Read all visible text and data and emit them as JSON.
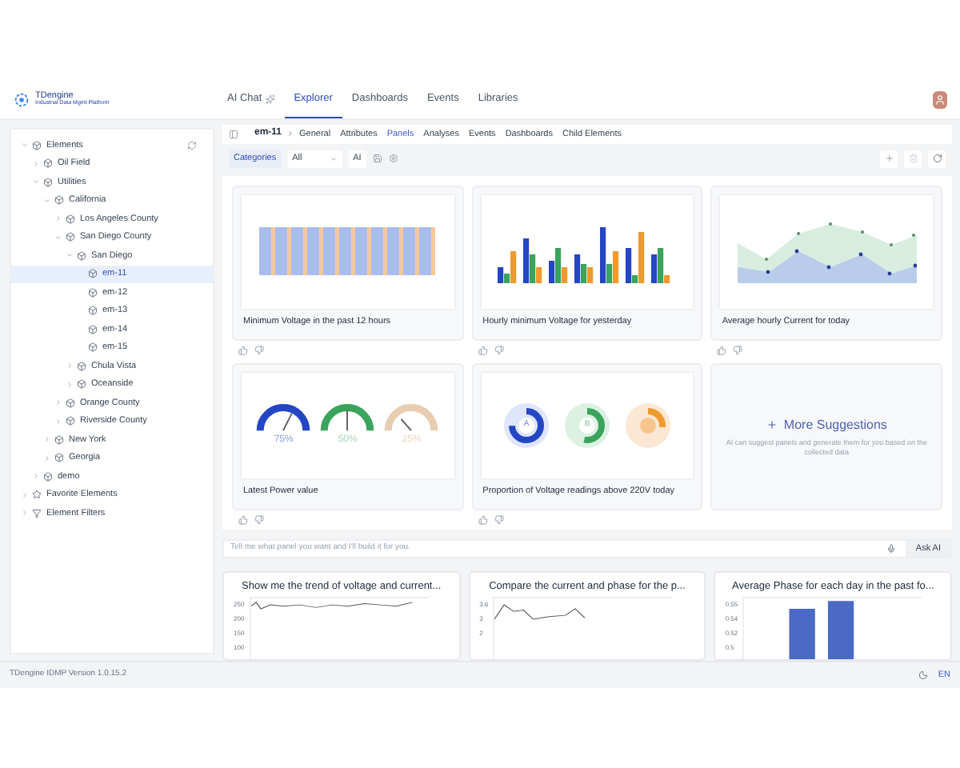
{
  "app": {
    "logo_title": "TDengine",
    "logo_subtitle": "Industrial Data Mgmt Platform"
  },
  "nav": [
    {
      "label": "AI Chat",
      "kind": "ai",
      "selected": false
    },
    {
      "label": "Explorer",
      "selected": true
    },
    {
      "label": "Dashboards",
      "selected": false
    },
    {
      "label": "Events",
      "selected": false
    },
    {
      "label": "Libraries",
      "selected": false
    }
  ],
  "tree": [
    {
      "label": "Elements",
      "kind": "root",
      "expanded": true,
      "selected": false,
      "children": [
        {
          "label": "Oil Field",
          "expanded": false,
          "selected": false
        },
        {
          "label": "Utilities",
          "expanded": true,
          "selected": false,
          "children": [
            {
              "label": "California",
              "expanded": true,
              "selected": false,
              "children": [
                {
                  "label": "Los Angeles County",
                  "expanded": false,
                  "selected": false
                },
                {
                  "label": "San Diego County",
                  "expanded": true,
                  "selected": false,
                  "children": [
                    {
                      "label": "San Diego",
                      "expanded": true,
                      "selected": false,
                      "children": [
                        {
                          "label": "em-11",
                          "selected": true
                        },
                        {
                          "label": "em-12",
                          "selected": false
                        },
                        {
                          "label": "em-13",
                          "selected": false
                        },
                        {
                          "label": "em-14",
                          "selected": false
                        },
                        {
                          "label": "em-15",
                          "selected": false
                        }
                      ]
                    },
                    {
                      "label": "Chula Vista",
                      "expanded": false,
                      "selected": false
                    },
                    {
                      "label": "Oceanside",
                      "expanded": false,
                      "selected": false
                    }
                  ]
                },
                {
                  "label": "Orange County",
                  "expanded": false,
                  "selected": false
                },
                {
                  "label": "Riverside County",
                  "expanded": false,
                  "selected": false
                }
              ]
            },
            {
              "label": "New York",
              "expanded": false,
              "selected": false
            },
            {
              "label": "Georgia",
              "expanded": false,
              "selected": false
            }
          ]
        },
        {
          "label": "demo",
          "expanded": false,
          "selected": false
        }
      ]
    },
    {
      "label": "Favorite Elements",
      "kind": "favorites",
      "expanded": false,
      "selected": false
    },
    {
      "label": "Element Filters",
      "kind": "filters",
      "expanded": false,
      "selected": false
    }
  ],
  "breadcrumb": "em-11",
  "tabs": [
    {
      "label": "General",
      "selected": false
    },
    {
      "label": "Attributes",
      "selected": false
    },
    {
      "label": "Panels",
      "selected": true
    },
    {
      "label": "Analyses",
      "selected": false
    },
    {
      "label": "Events",
      "selected": false
    },
    {
      "label": "Dashboards",
      "selected": false
    },
    {
      "label": "Child Elements",
      "selected": false
    }
  ],
  "toolbar": {
    "categories_label": "Categories",
    "select_value": "All",
    "ai_button": "AI"
  },
  "panels": [
    {
      "kind": "striped",
      "title": "Minimum Voltage in the past 12 hours"
    },
    {
      "kind": "grouped",
      "title": "Hourly minimum Voltage for yesterday"
    },
    {
      "kind": "area",
      "title": "Average hourly Current for today"
    },
    {
      "kind": "gauges",
      "title": "Latest Power value",
      "readings": [
        "75%",
        "50%",
        "25%"
      ]
    },
    {
      "kind": "donuts",
      "title": "Proportion of Voltage readings above 220V today",
      "labels": [
        "A",
        "B"
      ]
    },
    {
      "kind": "suggestion",
      "title": "More Suggestions",
      "text": "AI can suggest panels and generate them for you based on the collected data"
    }
  ],
  "ask": {
    "placeholder": "Tell me what panel you want and I'll build it for you.",
    "button": "Ask AI"
  },
  "bottom_charts": [
    {
      "kind": "line",
      "title": "Show me the trend of voltage and current...",
      "ticks": [
        "250",
        "200",
        "150",
        "100"
      ]
    },
    {
      "kind": "line2",
      "title": "Compare the current and phase for the p...",
      "ticks": [
        "3.6",
        "3",
        "2"
      ]
    },
    {
      "kind": "bar",
      "title": "Average Phase for each day in the past fo...",
      "ticks": [
        "0.55",
        "0.54",
        "0.52",
        "0.5"
      ]
    }
  ],
  "footer": {
    "version": "TDengine IDMP Version 1.0.15.2",
    "language": "EN"
  }
}
